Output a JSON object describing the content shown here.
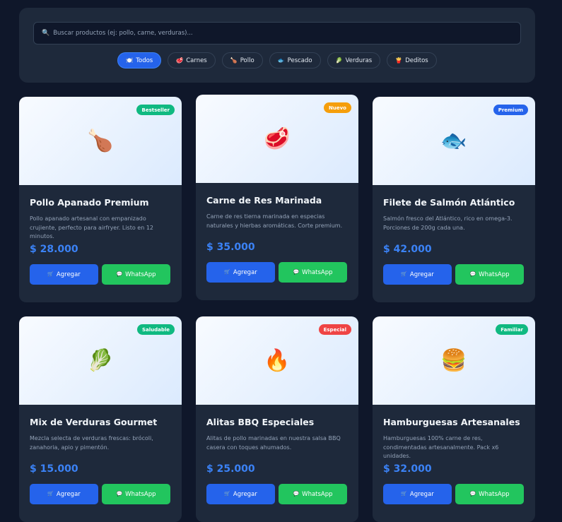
{
  "search": {
    "icon": "magnifier-icon",
    "icon_glyph": "🔍",
    "placeholder": "Buscar productos (ej: pollo, carne, verduras)..."
  },
  "filters": [
    {
      "label": "Todos",
      "glyph": "🍽️",
      "active": true
    },
    {
      "label": "Carnes",
      "glyph": "🥩",
      "active": false
    },
    {
      "label": "Pollo",
      "glyph": "🍗",
      "active": false
    },
    {
      "label": "Pescado",
      "glyph": "🐟",
      "active": false
    },
    {
      "label": "Verduras",
      "glyph": "🥬",
      "active": false
    },
    {
      "label": "Deditos",
      "glyph": "🍟",
      "active": false
    }
  ],
  "buttons": {
    "add_label": "Agregar",
    "add_glyph": "🛒",
    "whatsapp_label": "WhatsApp",
    "whatsapp_glyph": "💬"
  },
  "colors": {
    "background": "#0f172a",
    "card": "#1e293b",
    "primary": "#2563eb",
    "whatsapp": "#22c55e",
    "price": "#3b82f6"
  },
  "products": [
    {
      "name": "Pollo Apanado Premium",
      "description": "Pollo apanado artesanal con empanizado crujiente, perfecto para airfryer. Listo en 12 minutos.",
      "price": "$ 28.000",
      "badge": "Bestseller",
      "badge_color": "#10b981",
      "icon": "chicken-leg-icon",
      "glyph": "🍗"
    },
    {
      "name": "Carne de Res Marinada",
      "description": "Carne de res tierna marinada en especias naturales y hierbas aromáticas. Corte premium.",
      "price": "$ 35.000",
      "badge": "Nuevo",
      "badge_color": "#f59e0b",
      "icon": "meat-icon",
      "glyph": "🥩"
    },
    {
      "name": "Filete de Salmón Atlántico",
      "description": "Salmón fresco del Atlántico, rico en omega-3. Porciones de 200g cada una.",
      "price": "$ 42.000",
      "badge": "Premium",
      "badge_color": "#2563eb",
      "icon": "fish-icon",
      "glyph": "🐟"
    },
    {
      "name": "Mix de Verduras Gourmet",
      "description": "Mezcla selecta de verduras frescas: brócoli, zanahoria, apio y pimentón.",
      "price": "$ 15.000",
      "badge": "Saludable",
      "badge_color": "#10b981",
      "icon": "leafy-greens-icon",
      "glyph": "🥬"
    },
    {
      "name": "Alitas BBQ Especiales",
      "description": "Alitas de pollo marinadas en nuestra salsa BBQ casera con toques ahumados.",
      "price": "$ 25.000",
      "badge": "Especial",
      "badge_color": "#ef4444",
      "icon": "fire-icon",
      "glyph": "🔥"
    },
    {
      "name": "Hamburguesas Artesanales",
      "description": "Hamburguesas 100% carne de res, condimentadas artesanalmente. Pack x6 unidades.",
      "price": "$ 32.000",
      "badge": "Familiar",
      "badge_color": "#10b981",
      "icon": "burger-icon",
      "glyph": "🍔"
    }
  ]
}
